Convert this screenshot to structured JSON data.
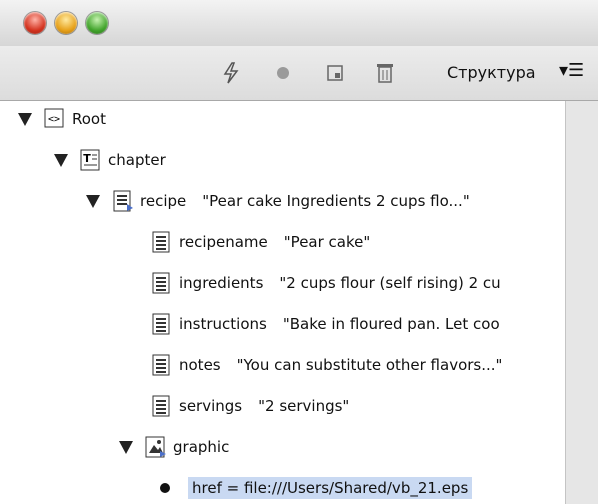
{
  "toolbar": {
    "icons": [
      "lightning-icon",
      "record-icon",
      "frame-icon",
      "trash-icon"
    ],
    "structure_label": "Структура",
    "menu_glyph": "▾☰"
  },
  "tree": [
    {
      "name": "Root",
      "value": "",
      "icon": "root-icon"
    },
    {
      "name": "chapter",
      "value": "",
      "icon": "text-frame-icon"
    },
    {
      "name": "recipe",
      "value": "\"Pear cake Ingredients 2 cups flo...\"",
      "icon": "element-icon"
    },
    {
      "name": "recipename",
      "value": "\"Pear cake\"",
      "icon": "element-icon"
    },
    {
      "name": "ingredients",
      "value": "\"2 cups flour (self rising) 2 cu",
      "icon": "element-icon"
    },
    {
      "name": "instructions",
      "value": "\"Bake in floured pan. Let coo",
      "icon": "element-icon"
    },
    {
      "name": "notes",
      "value": "\"You can substitute other flavors...\"",
      "icon": "element-icon"
    },
    {
      "name": "servings",
      "value": "\"2 servings\"",
      "icon": "element-icon"
    },
    {
      "name": "graphic",
      "value": "",
      "icon": "graphic-icon"
    },
    {
      "attribute": "href = file:///Users/Shared/vb_21.eps"
    }
  ]
}
